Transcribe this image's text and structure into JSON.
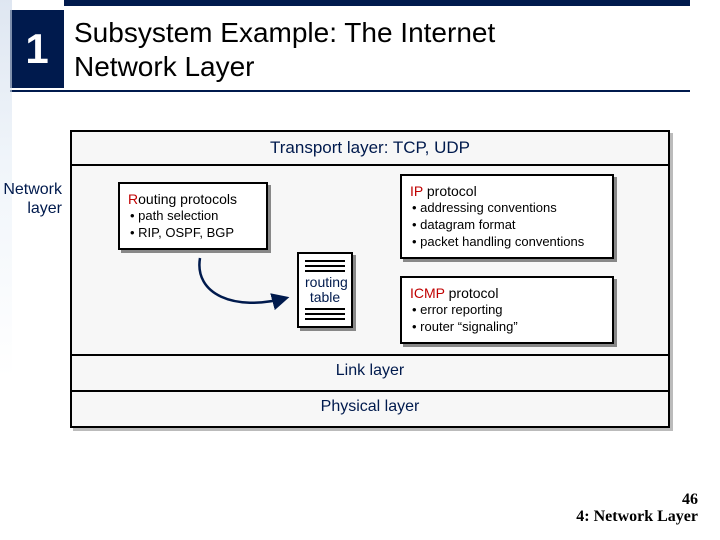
{
  "slide_number": "1",
  "title_line1": "Subsystem Example:  The Internet",
  "title_line2": "Network Layer",
  "layers": {
    "transport": "Transport layer: TCP, UDP",
    "link": "Link layer",
    "physical": "Physical layer"
  },
  "network_label_line1": "Network",
  "network_label_line2": "layer",
  "routing": {
    "header_accent": "R",
    "header_rest": "outing protocols",
    "items": [
      "path selection",
      "RIP, OSPF, BGP"
    ]
  },
  "routing_table": {
    "label_line1": "routing",
    "label_line2": "table"
  },
  "ip": {
    "header_accent": "IP",
    "header_rest": " protocol",
    "items": [
      "addressing conventions",
      "datagram format",
      "packet handling conventions"
    ]
  },
  "icmp": {
    "header_accent": "ICMP",
    "header_rest": " protocol",
    "items": [
      "error reporting",
      "router “signaling”"
    ]
  },
  "footer": {
    "page": "46",
    "chapter": "4: Network Layer"
  }
}
